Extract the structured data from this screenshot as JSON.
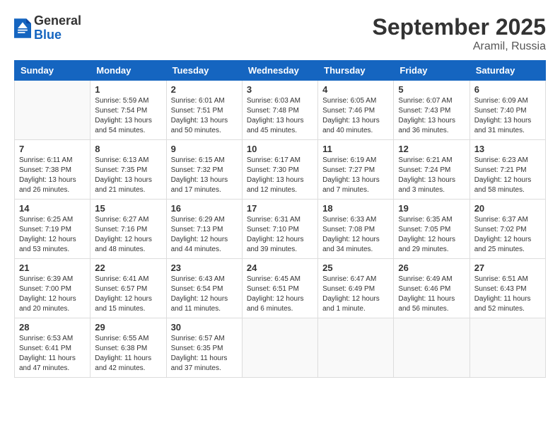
{
  "header": {
    "logo_general": "General",
    "logo_blue": "Blue",
    "month_title": "September 2025",
    "location": "Aramil, Russia"
  },
  "calendar": {
    "days_of_week": [
      "Sunday",
      "Monday",
      "Tuesday",
      "Wednesday",
      "Thursday",
      "Friday",
      "Saturday"
    ],
    "weeks": [
      [
        {
          "day": "",
          "info": ""
        },
        {
          "day": "1",
          "info": "Sunrise: 5:59 AM\nSunset: 7:54 PM\nDaylight: 13 hours\nand 54 minutes."
        },
        {
          "day": "2",
          "info": "Sunrise: 6:01 AM\nSunset: 7:51 PM\nDaylight: 13 hours\nand 50 minutes."
        },
        {
          "day": "3",
          "info": "Sunrise: 6:03 AM\nSunset: 7:48 PM\nDaylight: 13 hours\nand 45 minutes."
        },
        {
          "day": "4",
          "info": "Sunrise: 6:05 AM\nSunset: 7:46 PM\nDaylight: 13 hours\nand 40 minutes."
        },
        {
          "day": "5",
          "info": "Sunrise: 6:07 AM\nSunset: 7:43 PM\nDaylight: 13 hours\nand 36 minutes."
        },
        {
          "day": "6",
          "info": "Sunrise: 6:09 AM\nSunset: 7:40 PM\nDaylight: 13 hours\nand 31 minutes."
        }
      ],
      [
        {
          "day": "7",
          "info": "Sunrise: 6:11 AM\nSunset: 7:38 PM\nDaylight: 13 hours\nand 26 minutes."
        },
        {
          "day": "8",
          "info": "Sunrise: 6:13 AM\nSunset: 7:35 PM\nDaylight: 13 hours\nand 21 minutes."
        },
        {
          "day": "9",
          "info": "Sunrise: 6:15 AM\nSunset: 7:32 PM\nDaylight: 13 hours\nand 17 minutes."
        },
        {
          "day": "10",
          "info": "Sunrise: 6:17 AM\nSunset: 7:30 PM\nDaylight: 13 hours\nand 12 minutes."
        },
        {
          "day": "11",
          "info": "Sunrise: 6:19 AM\nSunset: 7:27 PM\nDaylight: 13 hours\nand 7 minutes."
        },
        {
          "day": "12",
          "info": "Sunrise: 6:21 AM\nSunset: 7:24 PM\nDaylight: 13 hours\nand 3 minutes."
        },
        {
          "day": "13",
          "info": "Sunrise: 6:23 AM\nSunset: 7:21 PM\nDaylight: 12 hours\nand 58 minutes."
        }
      ],
      [
        {
          "day": "14",
          "info": "Sunrise: 6:25 AM\nSunset: 7:19 PM\nDaylight: 12 hours\nand 53 minutes."
        },
        {
          "day": "15",
          "info": "Sunrise: 6:27 AM\nSunset: 7:16 PM\nDaylight: 12 hours\nand 48 minutes."
        },
        {
          "day": "16",
          "info": "Sunrise: 6:29 AM\nSunset: 7:13 PM\nDaylight: 12 hours\nand 44 minutes."
        },
        {
          "day": "17",
          "info": "Sunrise: 6:31 AM\nSunset: 7:10 PM\nDaylight: 12 hours\nand 39 minutes."
        },
        {
          "day": "18",
          "info": "Sunrise: 6:33 AM\nSunset: 7:08 PM\nDaylight: 12 hours\nand 34 minutes."
        },
        {
          "day": "19",
          "info": "Sunrise: 6:35 AM\nSunset: 7:05 PM\nDaylight: 12 hours\nand 29 minutes."
        },
        {
          "day": "20",
          "info": "Sunrise: 6:37 AM\nSunset: 7:02 PM\nDaylight: 12 hours\nand 25 minutes."
        }
      ],
      [
        {
          "day": "21",
          "info": "Sunrise: 6:39 AM\nSunset: 7:00 PM\nDaylight: 12 hours\nand 20 minutes."
        },
        {
          "day": "22",
          "info": "Sunrise: 6:41 AM\nSunset: 6:57 PM\nDaylight: 12 hours\nand 15 minutes."
        },
        {
          "day": "23",
          "info": "Sunrise: 6:43 AM\nSunset: 6:54 PM\nDaylight: 12 hours\nand 11 minutes."
        },
        {
          "day": "24",
          "info": "Sunrise: 6:45 AM\nSunset: 6:51 PM\nDaylight: 12 hours\nand 6 minutes."
        },
        {
          "day": "25",
          "info": "Sunrise: 6:47 AM\nSunset: 6:49 PM\nDaylight: 12 hours\nand 1 minute."
        },
        {
          "day": "26",
          "info": "Sunrise: 6:49 AM\nSunset: 6:46 PM\nDaylight: 11 hours\nand 56 minutes."
        },
        {
          "day": "27",
          "info": "Sunrise: 6:51 AM\nSunset: 6:43 PM\nDaylight: 11 hours\nand 52 minutes."
        }
      ],
      [
        {
          "day": "28",
          "info": "Sunrise: 6:53 AM\nSunset: 6:41 PM\nDaylight: 11 hours\nand 47 minutes."
        },
        {
          "day": "29",
          "info": "Sunrise: 6:55 AM\nSunset: 6:38 PM\nDaylight: 11 hours\nand 42 minutes."
        },
        {
          "day": "30",
          "info": "Sunrise: 6:57 AM\nSunset: 6:35 PM\nDaylight: 11 hours\nand 37 minutes."
        },
        {
          "day": "",
          "info": ""
        },
        {
          "day": "",
          "info": ""
        },
        {
          "day": "",
          "info": ""
        },
        {
          "day": "",
          "info": ""
        }
      ]
    ]
  }
}
